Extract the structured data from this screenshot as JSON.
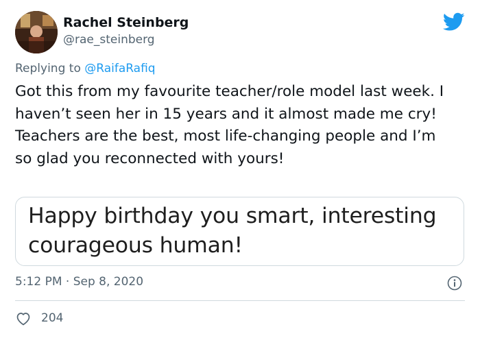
{
  "tweet": {
    "author_name": "Rachel Steinberg",
    "author_handle": "@rae_steinberg",
    "reply_prefix": "Replying to ",
    "reply_mention": "@RaifaRafiq",
    "text": "Got this from my favourite teacher/role model last week. I haven’t seen her in 15 years and it almost made me cry! Teachers are the best, most life-changing people and I’m so glad you reconnected with yours!",
    "card_text": "Happy birthday you smart, interesting courageous human!",
    "timestamp": "5:12 PM · Sep 8, 2020",
    "like_count": "204"
  },
  "icons": {
    "brand": "twitter-bird-icon",
    "info": "info-icon",
    "like": "heart-icon"
  },
  "colors": {
    "brand_blue": "#1d9bf0",
    "secondary_text": "#536471",
    "border": "#cfd9de"
  }
}
